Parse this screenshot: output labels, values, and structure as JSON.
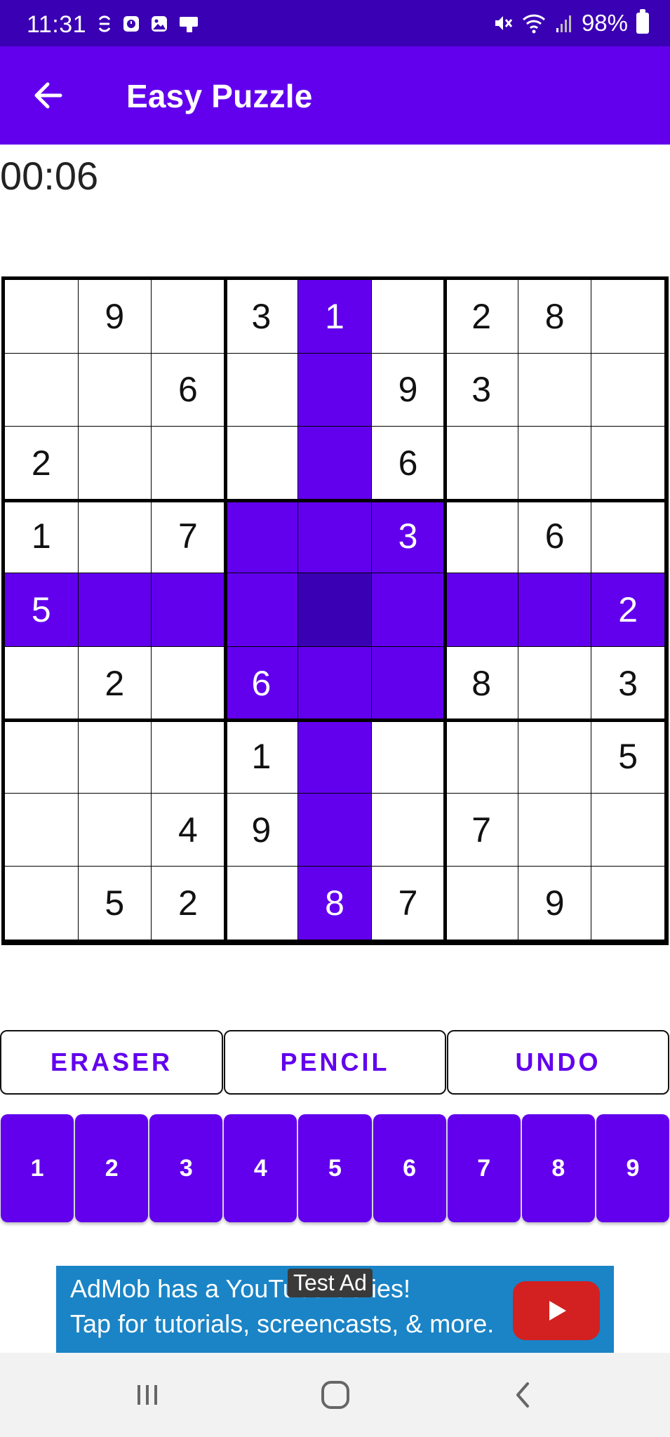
{
  "status_bar": {
    "time": "11:31",
    "battery": "98%",
    "icons_left": [
      "sync-icon",
      "clock-icon",
      "image-icon",
      "screen-icon"
    ],
    "icons_right": [
      "mute-icon",
      "wifi-icon",
      "signal-icon",
      "battery-icon"
    ]
  },
  "app_bar": {
    "title": "Easy Puzzle",
    "back_icon": "arrow-left-icon"
  },
  "timer": "00:06",
  "board": {
    "cells": [
      [
        "",
        "9",
        "",
        "3",
        "1",
        "",
        "2",
        "8",
        ""
      ],
      [
        "",
        "",
        "6",
        "",
        "",
        "9",
        "3",
        "",
        ""
      ],
      [
        "2",
        "",
        "",
        "",
        "",
        "6",
        "",
        "",
        ""
      ],
      [
        "1",
        "",
        "7",
        "",
        "",
        "3",
        "",
        "6",
        ""
      ],
      [
        "5",
        "",
        "",
        "",
        "",
        "",
        "",
        "",
        "2"
      ],
      [
        "",
        "2",
        "",
        "6",
        "",
        "",
        "8",
        "",
        "3"
      ],
      [
        "",
        "",
        "",
        "1",
        "",
        "",
        "",
        "",
        "5"
      ],
      [
        "",
        "",
        "4",
        "9",
        "",
        "",
        "7",
        "",
        ""
      ],
      [
        "",
        "5",
        "2",
        "",
        "8",
        "7",
        "",
        "9",
        ""
      ]
    ],
    "selected": {
      "row": 4,
      "col": 4
    },
    "highlight_color": "#6200EE",
    "selected_color": "#3A00B3"
  },
  "actions": {
    "eraser": "ERASER",
    "pencil": "PENCIL",
    "undo": "UNDO"
  },
  "numpad": [
    "1",
    "2",
    "3",
    "4",
    "5",
    "6",
    "7",
    "8",
    "9"
  ],
  "ad": {
    "line1": "AdMob has a YouTube Series!",
    "line2": "Tap for tutorials, screencasts, & more.",
    "label": "Test Ad"
  },
  "nav_bar": {
    "items": [
      "recent-apps-icon",
      "home-icon",
      "back-icon"
    ]
  },
  "colors": {
    "primary": "#6200EE",
    "primary_dark": "#3A00B3",
    "ad_blue": "#1a84c6"
  }
}
